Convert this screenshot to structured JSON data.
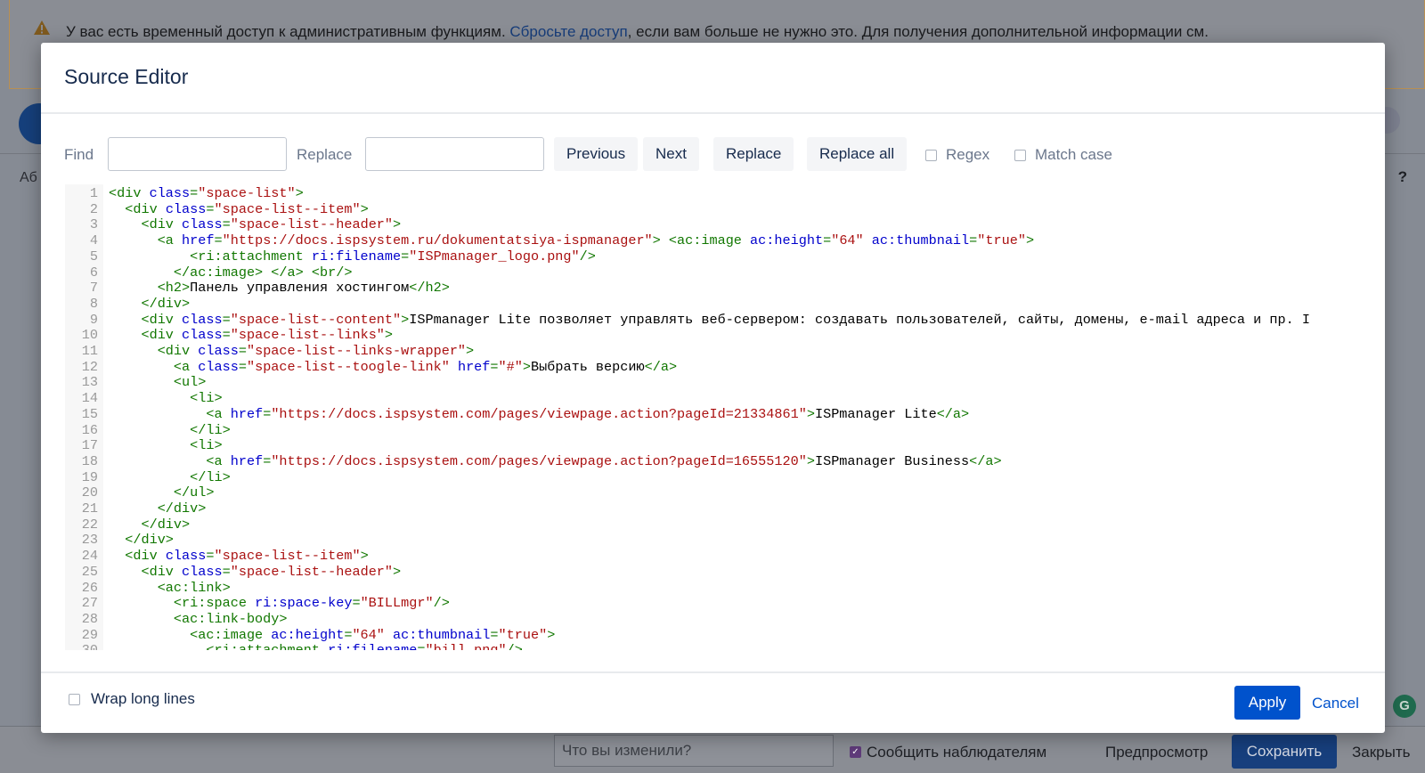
{
  "background": {
    "banner": {
      "text_before": "У вас есть временный доступ к административным функциям. ",
      "link": "Сбросьте доступ",
      "text_after": ", если вам больше не нужно это. Для получения дополнительной информации см."
    },
    "toolbar_text": "Аб",
    "help": "?",
    "bottom": {
      "comment_placeholder": "Что вы изменили?",
      "notify_label": "Сообщить наблюдателям",
      "preview": "Предпросмотр",
      "save": "Сохранить",
      "close": "Закрыть"
    },
    "grammarly": "G"
  },
  "modal": {
    "title": "Source Editor",
    "find_label": "Find",
    "find_value": "",
    "replace_label": "Replace",
    "replace_value": "",
    "buttons": {
      "previous": "Previous",
      "next": "Next",
      "replace": "Replace",
      "replace_all": "Replace all"
    },
    "regex_label": "Regex",
    "match_case_label": "Match case",
    "wrap_label": "Wrap long lines",
    "apply": "Apply",
    "cancel": "Cancel"
  },
  "code_lines": [
    [
      [
        "t",
        "<div "
      ],
      [
        "a",
        "class"
      ],
      [
        "t",
        "="
      ],
      [
        "s",
        "\"space-list\""
      ],
      [
        "t",
        ">"
      ]
    ],
    [
      [
        "x",
        "  "
      ],
      [
        "t",
        "<div "
      ],
      [
        "a",
        "class"
      ],
      [
        "t",
        "="
      ],
      [
        "s",
        "\"space-list--item\""
      ],
      [
        "t",
        ">"
      ]
    ],
    [
      [
        "x",
        "    "
      ],
      [
        "t",
        "<div "
      ],
      [
        "a",
        "class"
      ],
      [
        "t",
        "="
      ],
      [
        "s",
        "\"space-list--header\""
      ],
      [
        "t",
        ">"
      ]
    ],
    [
      [
        "x",
        "      "
      ],
      [
        "t",
        "<a "
      ],
      [
        "a",
        "href"
      ],
      [
        "t",
        "="
      ],
      [
        "s",
        "\"https://docs.ispsystem.ru/dokumentatsiya-ispmanager\""
      ],
      [
        "t",
        "> <ac:image "
      ],
      [
        "a",
        "ac:height"
      ],
      [
        "t",
        "="
      ],
      [
        "s",
        "\"64\""
      ],
      [
        "x",
        " "
      ],
      [
        "a",
        "ac:thumbnail"
      ],
      [
        "t",
        "="
      ],
      [
        "s",
        "\"true\""
      ],
      [
        "t",
        ">"
      ]
    ],
    [
      [
        "x",
        "          "
      ],
      [
        "t",
        "<ri:attachment "
      ],
      [
        "a",
        "ri:filename"
      ],
      [
        "t",
        "="
      ],
      [
        "s",
        "\"ISPmanager_logo.png\""
      ],
      [
        "t",
        "/>"
      ]
    ],
    [
      [
        "x",
        "        "
      ],
      [
        "t",
        "</ac:image> </a> <br/>"
      ]
    ],
    [
      [
        "x",
        "      "
      ],
      [
        "t",
        "<h2>"
      ],
      [
        "x",
        "Панель управления хостингом"
      ],
      [
        "t",
        "</h2>"
      ]
    ],
    [
      [
        "x",
        "    "
      ],
      [
        "t",
        "</div>"
      ]
    ],
    [
      [
        "x",
        "    "
      ],
      [
        "t",
        "<div "
      ],
      [
        "a",
        "class"
      ],
      [
        "t",
        "="
      ],
      [
        "s",
        "\"space-list--content\""
      ],
      [
        "t",
        ">"
      ],
      [
        "x",
        "ISPmanager Lite позволяет управлять веб-сервером: создавать пользователей, сайты, домены, e-mail адреса и пр. I"
      ]
    ],
    [
      [
        "x",
        "    "
      ],
      [
        "t",
        "<div "
      ],
      [
        "a",
        "class"
      ],
      [
        "t",
        "="
      ],
      [
        "s",
        "\"space-list--links\""
      ],
      [
        "t",
        ">"
      ]
    ],
    [
      [
        "x",
        "      "
      ],
      [
        "t",
        "<div "
      ],
      [
        "a",
        "class"
      ],
      [
        "t",
        "="
      ],
      [
        "s",
        "\"space-list--links-wrapper\""
      ],
      [
        "t",
        ">"
      ]
    ],
    [
      [
        "x",
        "        "
      ],
      [
        "t",
        "<a "
      ],
      [
        "a",
        "class"
      ],
      [
        "t",
        "="
      ],
      [
        "s",
        "\"space-list--toogle-link\""
      ],
      [
        "x",
        " "
      ],
      [
        "a",
        "href"
      ],
      [
        "t",
        "="
      ],
      [
        "s",
        "\"#\""
      ],
      [
        "t",
        ">"
      ],
      [
        "x",
        "Выбрать версию"
      ],
      [
        "t",
        "</a>"
      ]
    ],
    [
      [
        "x",
        "        "
      ],
      [
        "t",
        "<ul>"
      ]
    ],
    [
      [
        "x",
        "          "
      ],
      [
        "t",
        "<li>"
      ]
    ],
    [
      [
        "x",
        "            "
      ],
      [
        "t",
        "<a "
      ],
      [
        "a",
        "href"
      ],
      [
        "t",
        "="
      ],
      [
        "s",
        "\"https://docs.ispsystem.com/pages/viewpage.action?pageId=21334861\""
      ],
      [
        "t",
        ">"
      ],
      [
        "x",
        "ISPmanager Lite"
      ],
      [
        "t",
        "</a>"
      ]
    ],
    [
      [
        "x",
        "          "
      ],
      [
        "t",
        "</li>"
      ]
    ],
    [
      [
        "x",
        "          "
      ],
      [
        "t",
        "<li>"
      ]
    ],
    [
      [
        "x",
        "            "
      ],
      [
        "t",
        "<a "
      ],
      [
        "a",
        "href"
      ],
      [
        "t",
        "="
      ],
      [
        "s",
        "\"https://docs.ispsystem.com/pages/viewpage.action?pageId=16555120\""
      ],
      [
        "t",
        ">"
      ],
      [
        "x",
        "ISPmanager Business"
      ],
      [
        "t",
        "</a>"
      ]
    ],
    [
      [
        "x",
        "          "
      ],
      [
        "t",
        "</li>"
      ]
    ],
    [
      [
        "x",
        "        "
      ],
      [
        "t",
        "</ul>"
      ]
    ],
    [
      [
        "x",
        "      "
      ],
      [
        "t",
        "</div>"
      ]
    ],
    [
      [
        "x",
        "    "
      ],
      [
        "t",
        "</div>"
      ]
    ],
    [
      [
        "x",
        "  "
      ],
      [
        "t",
        "</div>"
      ]
    ],
    [
      [
        "x",
        "  "
      ],
      [
        "t",
        "<div "
      ],
      [
        "a",
        "class"
      ],
      [
        "t",
        "="
      ],
      [
        "s",
        "\"space-list--item\""
      ],
      [
        "t",
        ">"
      ]
    ],
    [
      [
        "x",
        "    "
      ],
      [
        "t",
        "<div "
      ],
      [
        "a",
        "class"
      ],
      [
        "t",
        "="
      ],
      [
        "s",
        "\"space-list--header\""
      ],
      [
        "t",
        ">"
      ]
    ],
    [
      [
        "x",
        "      "
      ],
      [
        "t",
        "<ac:link>"
      ]
    ],
    [
      [
        "x",
        "        "
      ],
      [
        "t",
        "<ri:space "
      ],
      [
        "a",
        "ri:space-key"
      ],
      [
        "t",
        "="
      ],
      [
        "s",
        "\"BILLmgr\""
      ],
      [
        "t",
        "/>"
      ]
    ],
    [
      [
        "x",
        "        "
      ],
      [
        "t",
        "<ac:link-body>"
      ]
    ],
    [
      [
        "x",
        "          "
      ],
      [
        "t",
        "<ac:image "
      ],
      [
        "a",
        "ac:height"
      ],
      [
        "t",
        "="
      ],
      [
        "s",
        "\"64\""
      ],
      [
        "x",
        " "
      ],
      [
        "a",
        "ac:thumbnail"
      ],
      [
        "t",
        "="
      ],
      [
        "s",
        "\"true\""
      ],
      [
        "t",
        ">"
      ]
    ],
    [
      [
        "x",
        "            "
      ],
      [
        "t",
        "<ri:attachment "
      ],
      [
        "a",
        "ri:filename"
      ],
      [
        "t",
        "="
      ],
      [
        "s",
        "\"bill.png\""
      ],
      [
        "t",
        "/>"
      ]
    ]
  ]
}
